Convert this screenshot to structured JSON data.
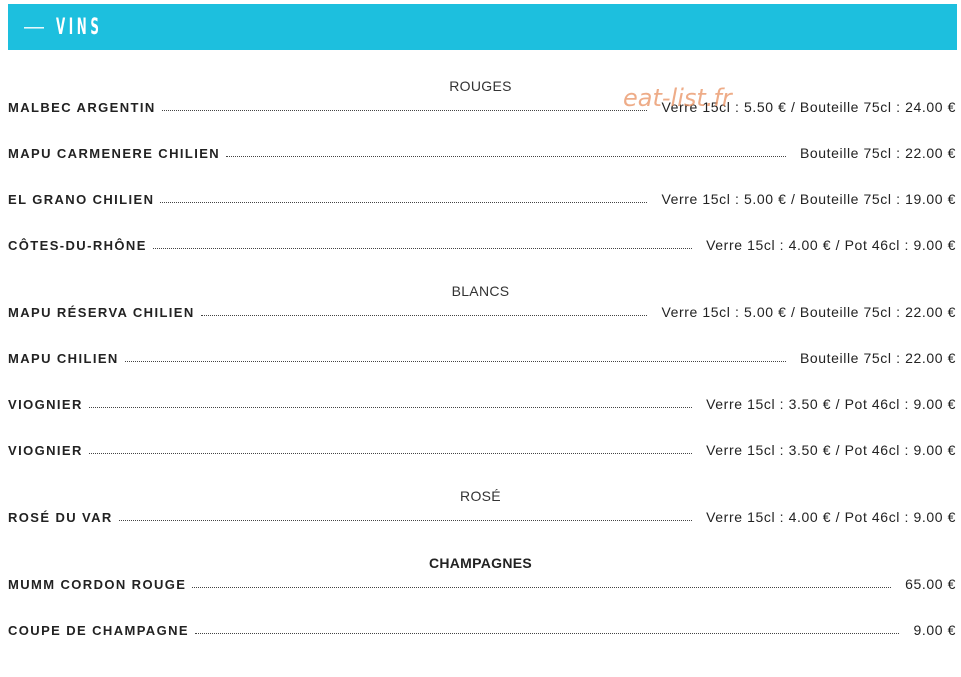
{
  "header": {
    "dash": "—",
    "title": "VINS"
  },
  "watermark": "eat-list.fr",
  "sections": [
    {
      "title": "ROUGES",
      "items": [
        {
          "name": "MALBEC ARGENTIN",
          "price": "Verre 15cl : 5.50 € / Bouteille 75cl : 24.00 €"
        },
        {
          "name": "MAPU CARMENERE CHILIEN",
          "price": "Bouteille 75cl : 22.00 €"
        },
        {
          "name": "EL GRANO CHILIEN",
          "price": "Verre 15cl : 5.00 € / Bouteille 75cl : 19.00 €"
        },
        {
          "name": "CÔTES-DU-RHÔNE",
          "price": "Verre 15cl : 4.00 € / Pot 46cl : 9.00 €"
        }
      ]
    },
    {
      "title": "BLANCS",
      "items": [
        {
          "name": "MAPU RÉSERVA CHILIEN",
          "price": "Verre 15cl : 5.00 € / Bouteille 75cl : 22.00 €"
        },
        {
          "name": "MAPU CHILIEN",
          "price": "Bouteille 75cl : 22.00 €"
        },
        {
          "name": "VIOGNIER",
          "price": "Verre 15cl : 3.50 € / Pot 46cl : 9.00 €"
        },
        {
          "name": "VIOGNIER",
          "price": "Verre 15cl : 3.50 € / Pot 46cl : 9.00 €"
        }
      ]
    },
    {
      "title": "ROSÉ",
      "items": [
        {
          "name": "ROSÉ DU VAR",
          "price": "Verre 15cl : 4.00 € / Pot 46cl : 9.00 €"
        }
      ]
    },
    {
      "title": "CHAMPAGNES",
      "items": [
        {
          "name": "MUMM CORDON ROUGE",
          "price": "65.00 €"
        },
        {
          "name": "COUPE DE CHAMPAGNE",
          "price": "9.00 €"
        }
      ]
    }
  ]
}
